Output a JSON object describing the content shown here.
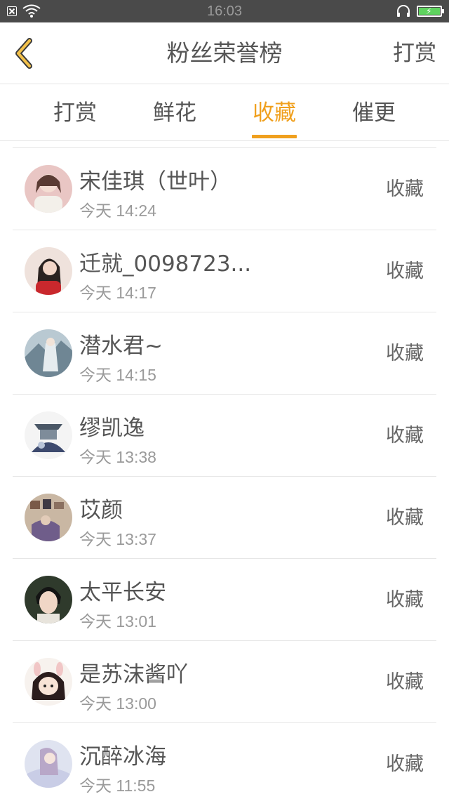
{
  "status_bar": {
    "time": "16:03"
  },
  "header": {
    "title": "粉丝荣誉榜",
    "right_action": "打赏"
  },
  "tabs": [
    {
      "label": "打赏",
      "active": false
    },
    {
      "label": "鲜花",
      "active": false
    },
    {
      "label": "收藏",
      "active": true
    },
    {
      "label": "催更",
      "active": false
    }
  ],
  "colors": {
    "accent": "#f0a01e",
    "divider": "#e6e6e6",
    "status_bar": "#4a4a4a"
  },
  "list": [
    {
      "name": "宋佳琪（世叶）",
      "time": "今天 14:24",
      "action": "收藏"
    },
    {
      "name": "迁就_0098723...",
      "time": "今天 14:17",
      "action": "收藏"
    },
    {
      "name": "潜水君~",
      "time": "今天 14:15",
      "action": "收藏"
    },
    {
      "name": "缪凯逸",
      "time": "今天 13:38",
      "action": "收藏"
    },
    {
      "name": "苡颜",
      "time": "今天 13:37",
      "action": "收藏"
    },
    {
      "name": "太平长安",
      "time": "今天 13:01",
      "action": "收藏"
    },
    {
      "name": "是苏沫酱吖",
      "time": "今天 13:00",
      "action": "收藏"
    },
    {
      "name": "沉醉冰海",
      "time": "今天 11:55",
      "action": "收藏"
    }
  ]
}
